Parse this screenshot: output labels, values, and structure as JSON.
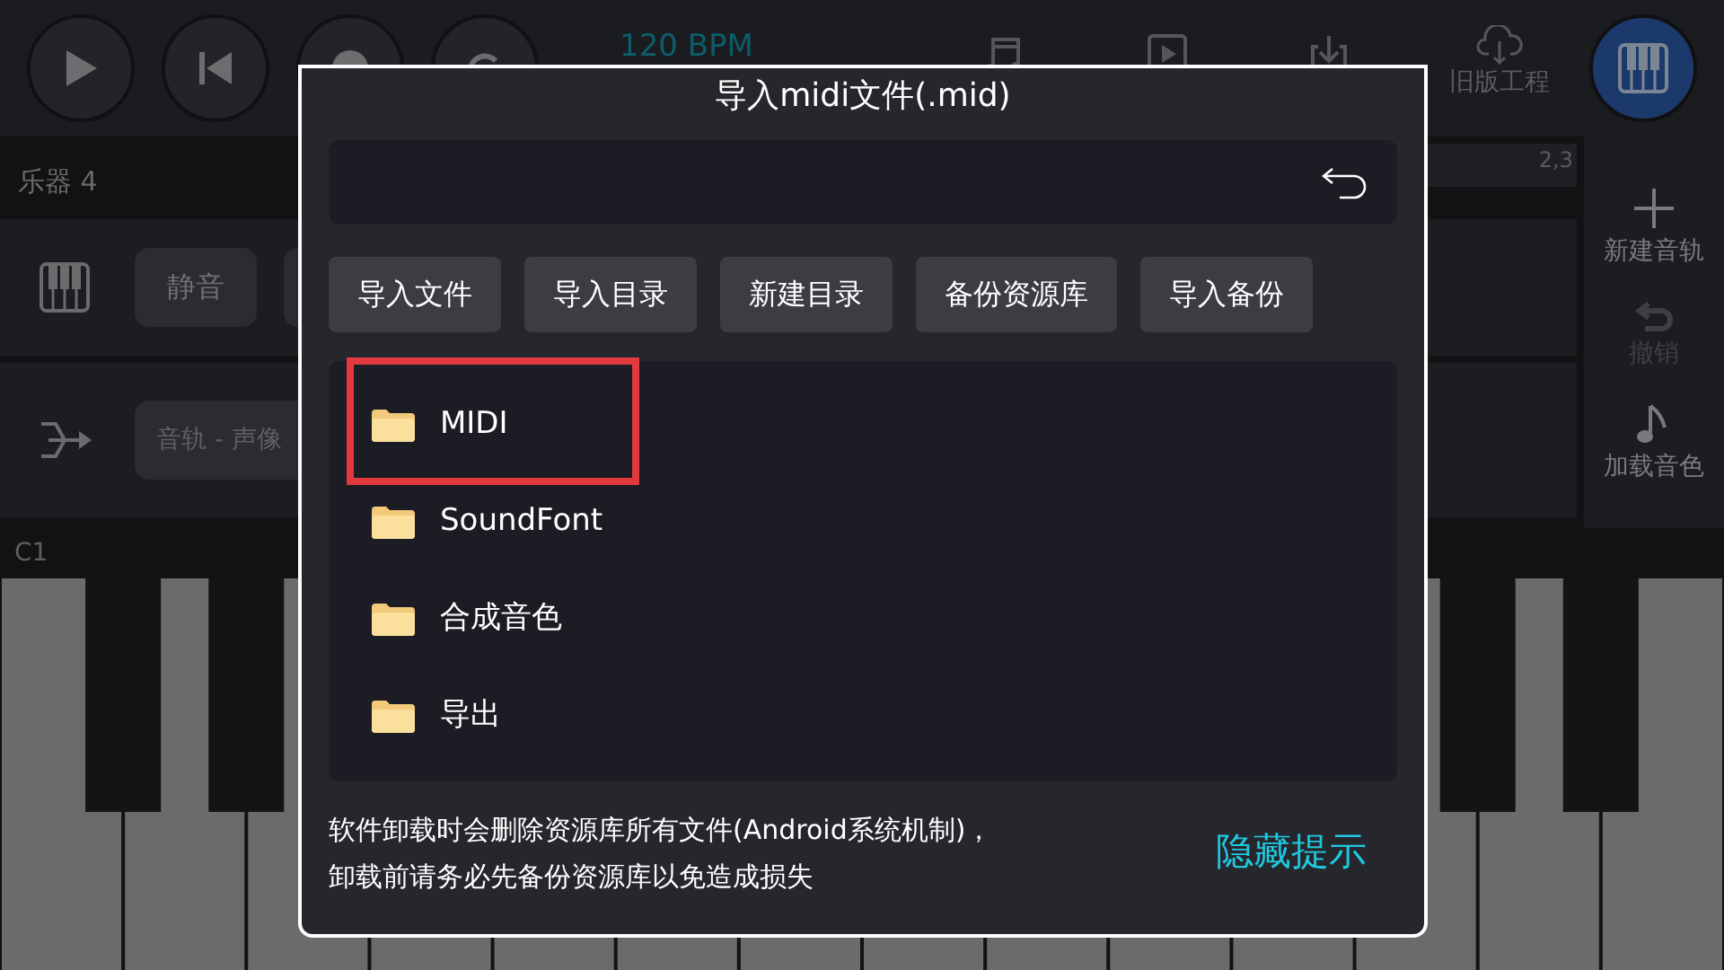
{
  "toolbar": {
    "transport": [
      {
        "kind": "play"
      },
      {
        "kind": "rewind"
      },
      {
        "kind": "record"
      },
      {
        "kind": "loop"
      }
    ],
    "tempo": "120 BPM",
    "tools": [
      {
        "kind": "notes"
      },
      {
        "kind": "video"
      },
      {
        "kind": "download"
      }
    ],
    "cloud_label": "旧版工程",
    "piano_selected": true
  },
  "track_header": {
    "label": "乐器 4",
    "ruler": "2,3"
  },
  "track": {
    "mute": "静音",
    "pan_field": "音轨 - 声像"
  },
  "side_panel": [
    {
      "kind": "add",
      "label": "新建音轨",
      "disabled": false
    },
    {
      "kind": "undo",
      "label": "撤销",
      "disabled": true
    },
    {
      "kind": "note",
      "label": "加载音色",
      "disabled": false
    }
  ],
  "keyboard": {
    "label": "C1"
  },
  "dialog": {
    "title": "导入midi文件(.mid)",
    "buttons": [
      "导入文件",
      "导入目录",
      "新建目录",
      "备份资源库",
      "导入备份"
    ],
    "items": [
      {
        "name": "MIDI",
        "highlighted": true
      },
      {
        "name": "SoundFont",
        "highlighted": false
      },
      {
        "name": "合成音色",
        "highlighted": false
      },
      {
        "name": "导出",
        "highlighted": false
      }
    ],
    "notice": [
      "软件卸载时会删除资源库所有文件(Android系统机制)，",
      "卸载前请务必先备份资源库以免造成损失"
    ],
    "hide_link": "隐藏提示"
  }
}
